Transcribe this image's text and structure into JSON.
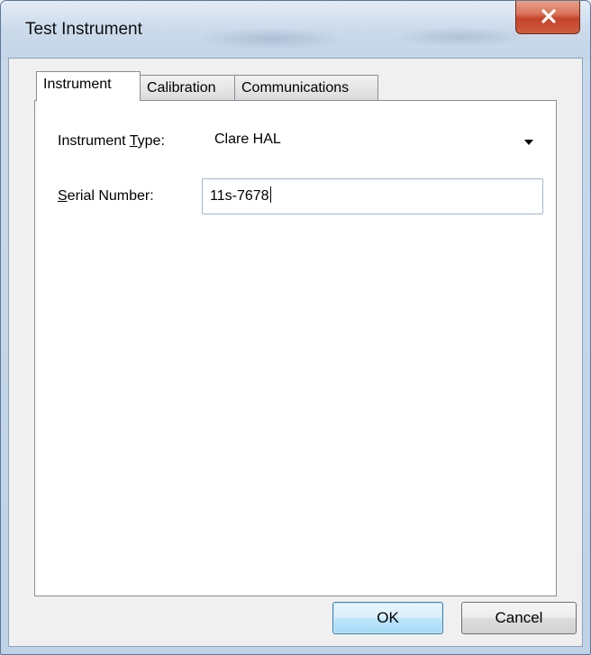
{
  "window": {
    "title": "Test Instrument"
  },
  "tabs": [
    {
      "label": "Instrument",
      "active": true
    },
    {
      "label": "Calibration",
      "active": false
    },
    {
      "label": "Communications",
      "active": false
    }
  ],
  "form": {
    "instrument_type": {
      "label_prefix": "Instrument ",
      "label_underlined": "T",
      "label_suffix": "ype:",
      "value": "Clare HAL"
    },
    "serial_number": {
      "label_underlined": "S",
      "label_suffix": "erial Number:",
      "value": "11s-7678"
    }
  },
  "buttons": {
    "ok": "OK",
    "cancel": "Cancel"
  },
  "colors": {
    "close_button": "#c4432a",
    "default_button_border": "#3c7fb1"
  },
  "icons": {
    "close": "close-x-icon",
    "dropdown": "chevron-down-icon"
  }
}
